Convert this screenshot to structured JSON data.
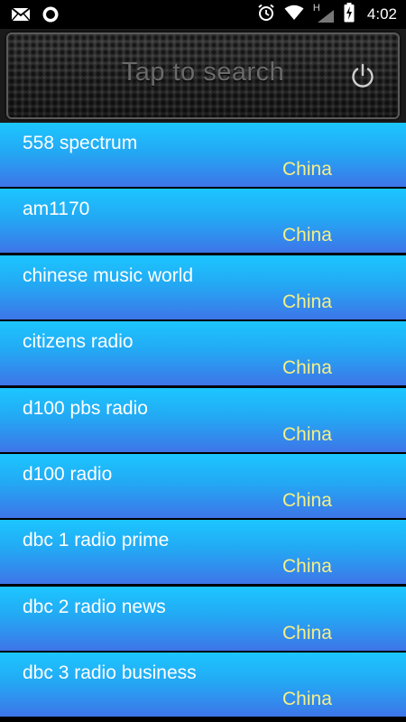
{
  "status_bar": {
    "time": "4:02",
    "icons_left": [
      "gmail-icon",
      "circle-app-icon"
    ],
    "icons_right": [
      "alarm-icon",
      "wifi-icon",
      "h-network-signal-icon",
      "battery-charging-icon"
    ],
    "network_label": "H"
  },
  "header": {
    "search_placeholder": "Tap to search",
    "power_icon": "power-icon"
  },
  "stations": [
    {
      "name": "558 spectrum",
      "country": "China"
    },
    {
      "name": "am1170",
      "country": "China"
    },
    {
      "name": "chinese music world",
      "country": "China"
    },
    {
      "name": "citizens radio",
      "country": "China"
    },
    {
      "name": "d100 pbs radio",
      "country": "China"
    },
    {
      "name": "d100 radio",
      "country": "China"
    },
    {
      "name": "dbc 1 radio prime",
      "country": "China"
    },
    {
      "name": "dbc 2 radio news",
      "country": "China"
    },
    {
      "name": "dbc 3 radio business",
      "country": "China"
    }
  ],
  "colors": {
    "row_top": "#1cc6ff",
    "row_bottom": "#3d75e8",
    "station_name": "#ffffff",
    "country": "#f6ef86",
    "search_text": "#6a6a6a"
  }
}
